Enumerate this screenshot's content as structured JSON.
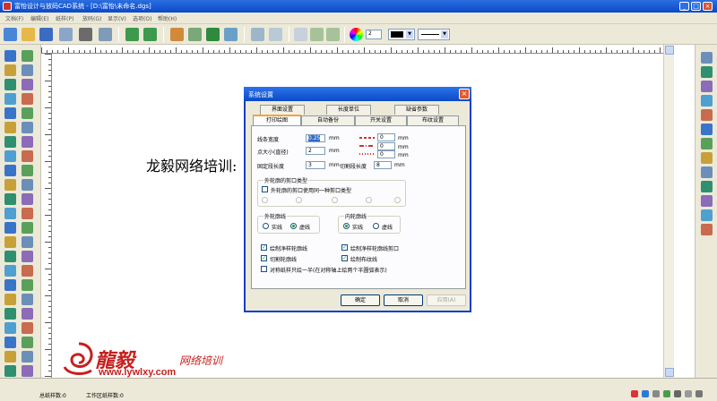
{
  "window": {
    "title": "富怡设计与放码CAD系统  - [D:\\富怡\\未命名.dgs]"
  },
  "menu": [
    "文档(F)",
    "编辑(E)",
    "纸样(P)",
    "放码(G)",
    "显示(V)",
    "选项(O)",
    "帮助(H)"
  ],
  "toolbar": {
    "linewidth_value": "2"
  },
  "canvas": {
    "text": "龙毅网络培训:"
  },
  "dialog": {
    "title": "系统设置",
    "tabs_back": [
      "界面设置",
      "长度单位",
      "缺省参数"
    ],
    "tabs_front": [
      "打印绘图",
      "自动备份",
      "开关设置",
      "布纹设置"
    ],
    "fields": {
      "line_width_label": "线条宽度",
      "line_width_value": "0.25",
      "point_size_label": "点大小(直径)",
      "point_size_value": "2",
      "fixed_segment_label": "固定段长度",
      "fixed_segment_value": "3",
      "cut_segment_label": "切割段长度",
      "cut_segment_value": "8",
      "unit": "mm",
      "right_values": [
        "0",
        "0",
        "0"
      ]
    },
    "notch_group": {
      "title": "外轮廓的剪口类型",
      "checkbox_label": "外轮廓的剪口使用同一种剪口类型"
    },
    "outer_line_group": {
      "title": "外轮廓线",
      "options": [
        "实线",
        "虚线"
      ],
      "selected": "虚线"
    },
    "inner_line_group": {
      "title": "内轮廓线",
      "options": [
        "实线",
        "虚线"
      ],
      "selected": "实线"
    },
    "checkboxes": [
      {
        "label": "绘制净样轮廓线",
        "checked": true
      },
      {
        "label": "绘制净样轮廓线剪口",
        "checked": true
      },
      {
        "label": "切割轮廓线",
        "checked": true
      },
      {
        "label": "绘制布纹线",
        "checked": true
      },
      {
        "label": "对称纸样只绘一半(在对称轴上绘两个半圆弧表示)",
        "checked": false
      }
    ],
    "buttons": {
      "ok": "确定",
      "cancel": "取消",
      "apply": "应用(A)"
    }
  },
  "status": {
    "total_count_label": "总纸样数:0",
    "work_count_label": "工作区纸样数:0"
  },
  "watermark": {
    "brand": "龍毅",
    "subtitle": "网络培训",
    "url": "www.lywlxy.com"
  },
  "colors": {
    "titlebar": "#0a49c9",
    "brand_red": "#c6201d",
    "chrome": "#ece9d8"
  }
}
